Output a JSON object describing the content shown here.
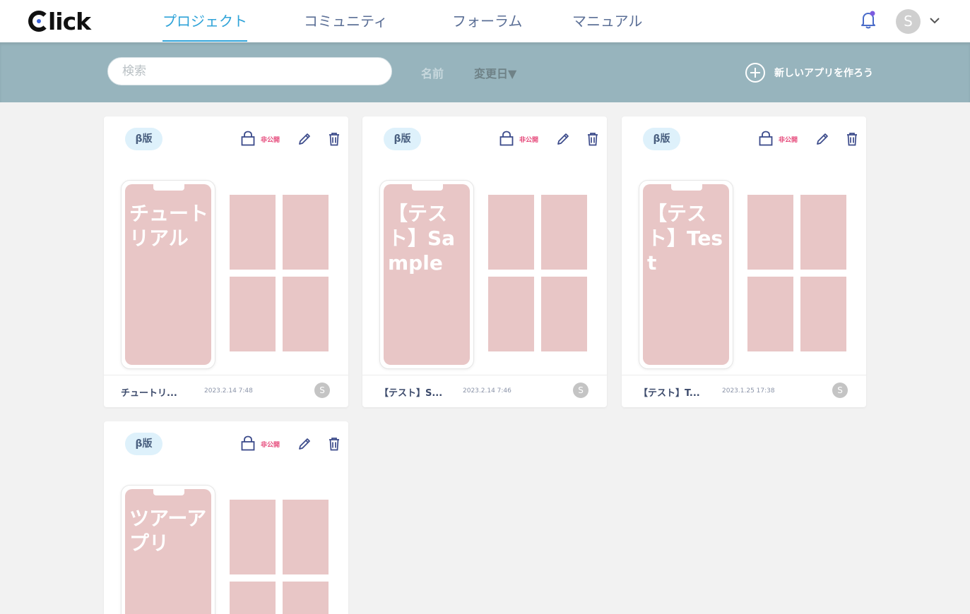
{
  "app": {
    "logo_text": "lick"
  },
  "nav": [
    {
      "label": "プロジェクト",
      "active": true
    },
    {
      "label": "コミュニティ",
      "active": false
    },
    {
      "label": "フォーラム",
      "active": false
    },
    {
      "label": "マニュアル",
      "active": false
    }
  ],
  "user": {
    "initial": "S"
  },
  "toolbar": {
    "search_placeholder": "検索",
    "sort_name": "名前",
    "sort_date": "変更日▼",
    "new_app": "新しいアプリを作ろう"
  },
  "projects": [
    {
      "badge": "β版",
      "visibility": "非公開",
      "screen_title": "チュートリアル",
      "name": "チュートリ...",
      "date": "2023.2.14 7:48",
      "owner": "S"
    },
    {
      "badge": "β版",
      "visibility": "非公開",
      "screen_title": "【テスト】Sample",
      "name": "【テスト】S...",
      "date": "2023.2.14 7:46",
      "owner": "S"
    },
    {
      "badge": "β版",
      "visibility": "非公開",
      "screen_title": "【テスト】Test",
      "name": "【テスト】T...",
      "date": "2023.1.25 17:38",
      "owner": "S"
    },
    {
      "badge": "β版",
      "visibility": "非公開",
      "screen_title": "ツアーアプリ",
      "name": "",
      "date": "",
      "owner": ""
    }
  ],
  "colors": {
    "accent": "#2fa3d8",
    "toolbar": "#97b4bd",
    "tile": "#e8c6c6",
    "private": "#e64a7b",
    "icon": "#3b4a8a"
  }
}
